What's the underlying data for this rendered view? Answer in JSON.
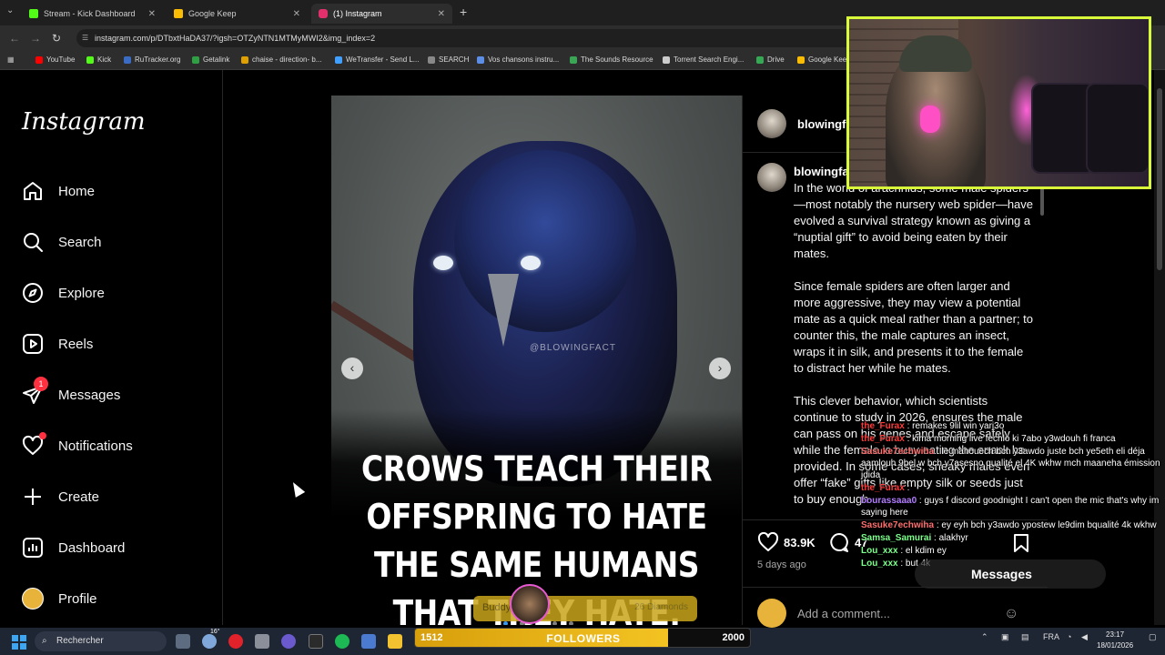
{
  "browser": {
    "tabs": [
      {
        "title": "Stream - Kick Dashboard",
        "color": "#53fc18"
      },
      {
        "title": "Google Keep",
        "color": "#fbbc04"
      },
      {
        "title": "(1) Instagram",
        "color": "#e1306c"
      }
    ],
    "url": "instagram.com/p/DTbxtHaDA37/?igsh=OTZyNTN1MTMyMWI2&img_index=2",
    "bookmarks": [
      {
        "label": "YouTube",
        "color": "#ff0000"
      },
      {
        "label": "Kick",
        "color": "#53fc18"
      },
      {
        "label": "RuTracker.org",
        "color": "#3b6cc4"
      },
      {
        "label": "Getalink",
        "color": "#2ea043"
      },
      {
        "label": "chaise - direction- b...",
        "color": "#e0a000"
      },
      {
        "label": "WeTransfer - Send L...",
        "color": "#409fff"
      },
      {
        "label": "SEARCH",
        "color": "#888888"
      },
      {
        "label": "Vos chansons instru...",
        "color": "#5d8ee6"
      },
      {
        "label": "The Sounds Resource",
        "color": "#3aa655"
      },
      {
        "label": "Torrent Search Engi...",
        "color": "#cccccc"
      },
      {
        "label": "Drive",
        "color": "#34a853"
      },
      {
        "label": "Google Keep",
        "color": "#fbbc04"
      }
    ]
  },
  "instagram": {
    "logo": "Instagram",
    "nav": [
      {
        "label": "Home",
        "icon": "home-icon"
      },
      {
        "label": "Search",
        "icon": "search-icon"
      },
      {
        "label": "Explore",
        "icon": "compass-icon"
      },
      {
        "label": "Reels",
        "icon": "reels-icon"
      },
      {
        "label": "Messages",
        "icon": "messenger-icon",
        "badge": "1"
      },
      {
        "label": "Notifications",
        "icon": "heart-icon"
      },
      {
        "label": "Create",
        "icon": "plus-icon"
      },
      {
        "label": "Dashboard",
        "icon": "dashboard-icon"
      },
      {
        "label": "Profile",
        "icon": "profile-avatar"
      }
    ]
  },
  "post": {
    "username": "blowingf",
    "caption_username": "blowingfa",
    "watermark": "@BLOWINGFACT",
    "headline": "CROWS TEACH THEIR OFFSPRING TO HATE THE SAME HUMANS THAT THEY HATE.",
    "caption_paragraphs": [
      "In the world of arachnids, some male spiders—most notably the nursery web spider—have evolved a survival strategy known as giving a “nuptial gift” to avoid being eaten by their mates.",
      "Since female spiders are often larger and more aggressive, they may view a potential mate as a quick meal rather than a partner; to counter this, the male captures an insect, wraps it in silk, and presents it to the female to distract her while he mates.",
      "This clever behavior, which scientists continue to study in 2026, ensures the male can pass on his genes and escape safely while the female is busy eating the snack he provided. In some cases, sneaky males even offer “fake” gifts like empty silk or seeds just to buy enough"
    ],
    "likes": "83.9K",
    "comments": "47",
    "posted": "5 days ago",
    "add_comment_placeholder": "Add a comment..."
  },
  "chat": [
    {
      "user": "the_Furax",
      "color": "#ff3b3b",
      "message": " : remakes 9lil win yarj3o"
    },
    {
      "user": "the_Furax",
      "color": "#ff3b3b",
      "message": " : kima morning live fechlo ki 7abo y3wdouh fi franca"
    },
    {
      "user": "Sasuke7echwiha",
      "color": "#ff6f6f",
      "message": " : le mahouech bch y3awdo juste bch ye5eth eli déja aamlouh 9bel w bch y7asesno qualité el 4K wkhw mch maaneha émission jdida"
    },
    {
      "user": "the_Furax",
      "color": "#ff3b3b",
      "message": " :"
    },
    {
      "user": "bourassaaa0",
      "color": "#b27cff",
      "message": " : guys f discord goodnight I can't open the mic that's why im saying here"
    },
    {
      "user": "Sasuke7echwiha",
      "color": "#ff6f6f",
      "message": " : ey eyh bch y3awdo ypostew le9dim bqualité 4k wkhw"
    },
    {
      "user": "Samsa_Samurai",
      "color": "#7cff8b",
      "message": " : alakhyr"
    },
    {
      "user": "Lou_xxx",
      "color": "#7cff8b",
      "message": " : el kdim ey"
    },
    {
      "user": "Lou_xxx",
      "color": "#7cff8b",
      "message": " : but 4k"
    }
  ],
  "messages_pill": "Messages",
  "gift": {
    "user": "Buddy2G",
    "amount": "26 Diamonds"
  },
  "followers": {
    "label": "FOLLOWERS",
    "current": "1512",
    "goal": "2000",
    "progress": 0.756
  },
  "taskbar": {
    "search_placeholder": "Rechercher",
    "weather": "16°",
    "lang": "FRA",
    "time": "23:17",
    "date": "18/01/2026"
  }
}
